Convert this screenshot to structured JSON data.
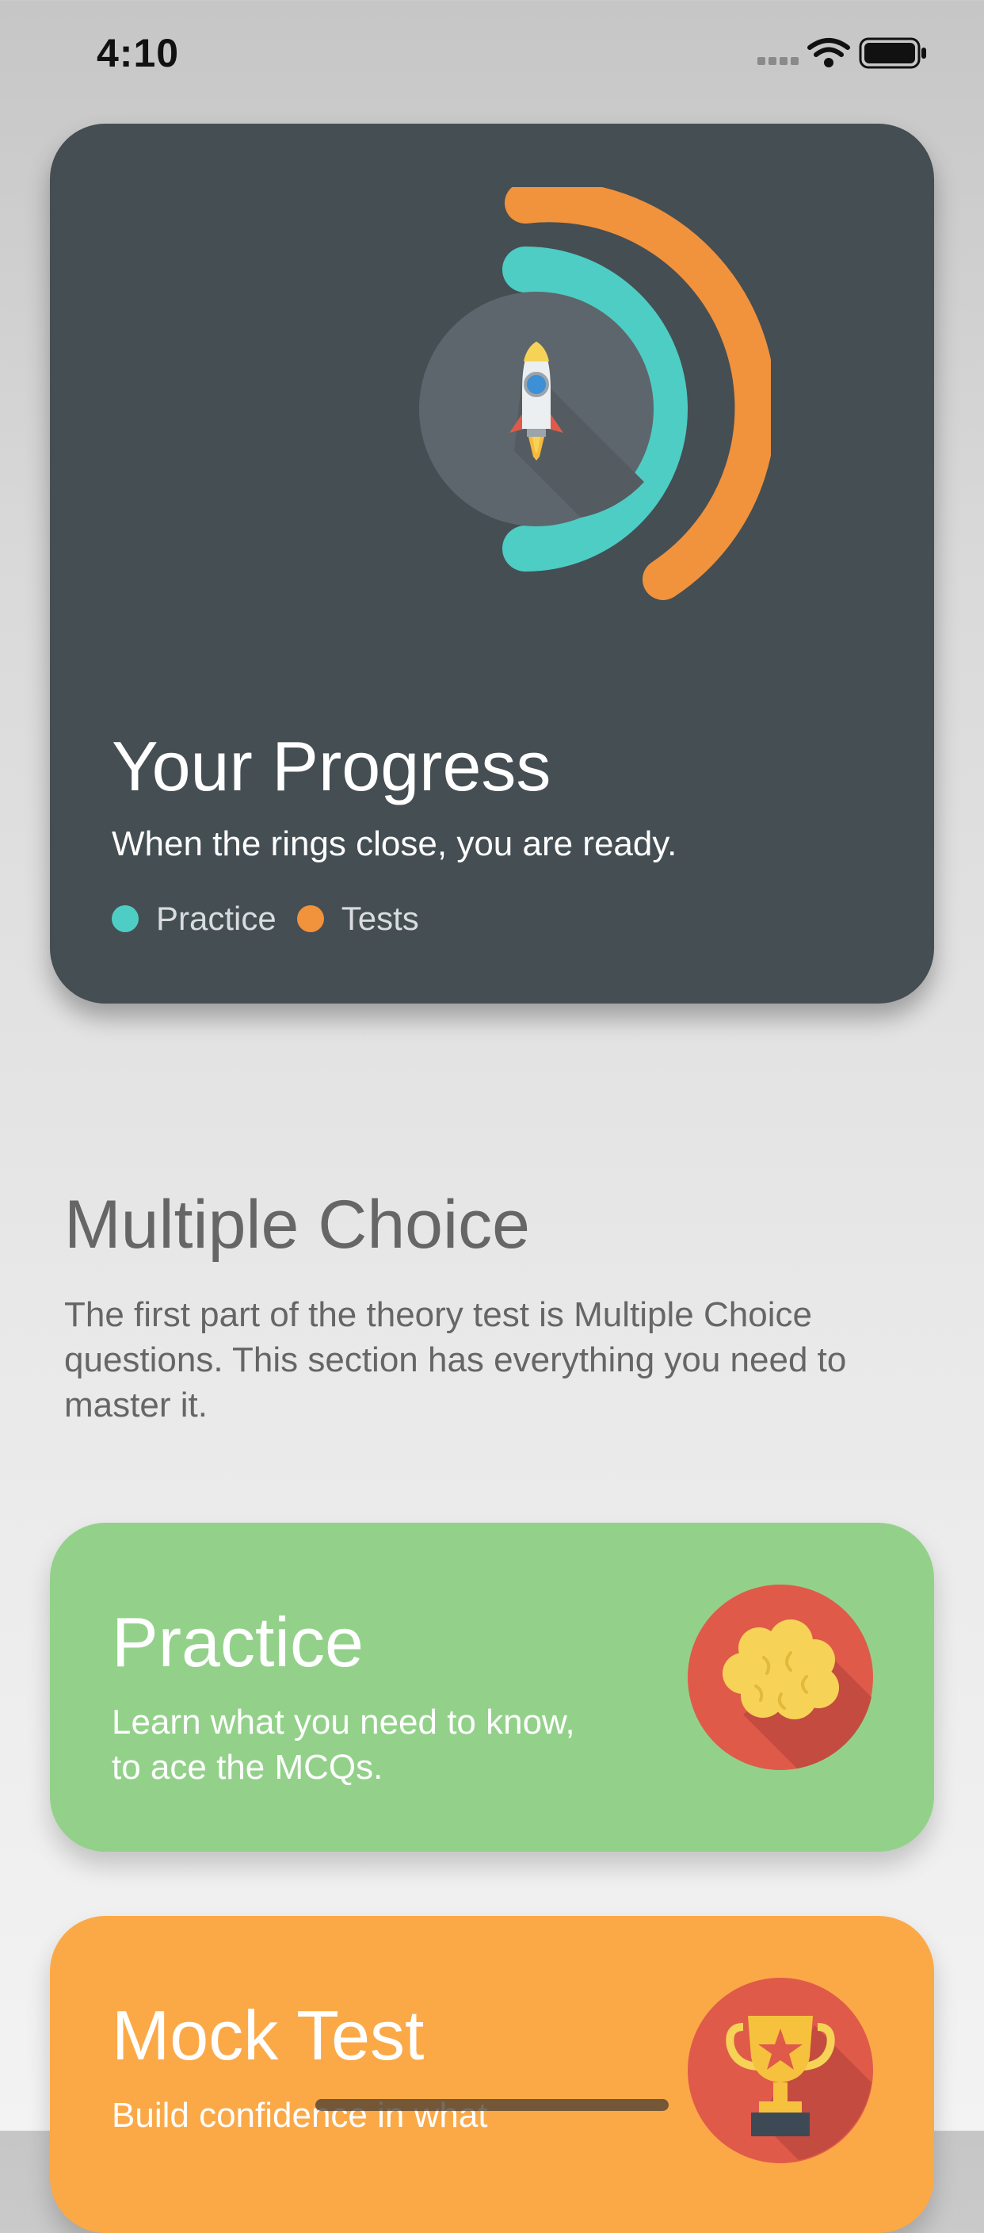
{
  "status_bar": {
    "time": "4:10",
    "signal_icon": "cellular-signal-icon",
    "wifi_icon": "wifi-icon",
    "battery_icon": "battery-icon"
  },
  "progress_card": {
    "title": "Your Progress",
    "subtitle": "When the rings close, you are ready.",
    "center_icon": "rocket-icon",
    "rings": [
      {
        "name": "Practice",
        "progress": 0.5,
        "color": "#4ecdc4"
      },
      {
        "name": "Tests",
        "progress": 0.6,
        "color": "#f1923c"
      }
    ],
    "legend": [
      {
        "label": "Practice",
        "color": "#4ecdc4"
      },
      {
        "label": "Tests",
        "color": "#f1923c"
      }
    ]
  },
  "section": {
    "title": "Multiple Choice",
    "description": "The first part of the theory test is Multiple Choice questions. This section has everything you need to master it."
  },
  "cards": {
    "practice": {
      "title": "Practice",
      "subtitle": "Learn what you need to know, to ace the MCQs.",
      "icon": "brain-icon",
      "color": "#93d18a"
    },
    "mock_test": {
      "title": "Mock Test",
      "subtitle": "Build confidence in what",
      "icon": "trophy-icon",
      "color": "#fba947"
    }
  }
}
